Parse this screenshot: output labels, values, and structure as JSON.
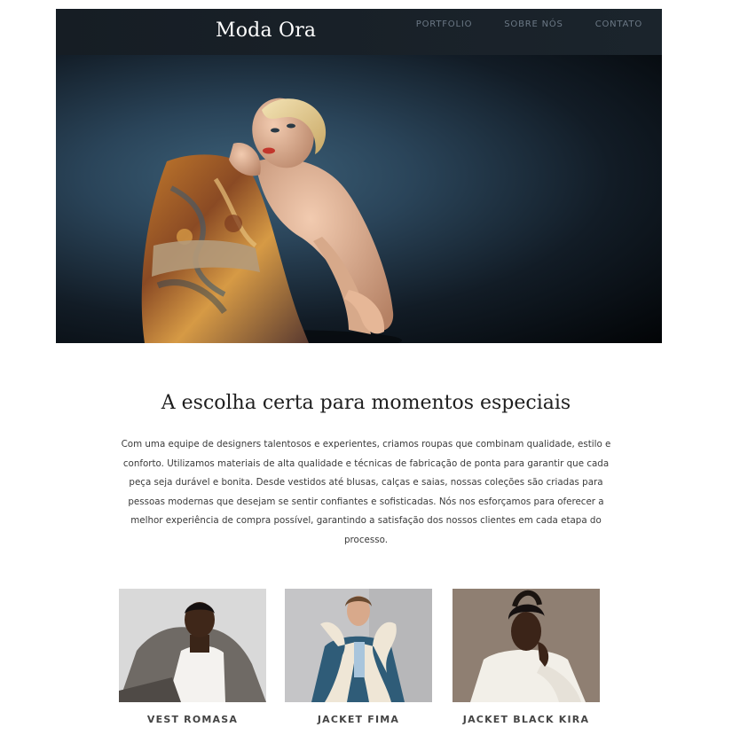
{
  "header": {
    "brand": "Moda Ora",
    "nav": [
      "PORTFOLIO",
      "SOBRE NÓS",
      "CONTATO"
    ]
  },
  "intro": {
    "title": "A escolha certa para momentos especiais",
    "text": "Com uma equipe de designers talentosos e experientes, criamos roupas que combinam qualidade, estilo e conforto. Utilizamos materiais de alta qualidade e técnicas de fabricação de ponta para garantir que cada peça seja durável e bonita. Desde vestidos até blusas, calças e saias, nossas coleções são criadas para pessoas modernas que desejam se sentir confiantes e sofisticadas. Nós nos esforçamos para oferecer a melhor experiência de compra possível, garantindo a satisfação dos nossos clientes em cada etapa do processo."
  },
  "products": [
    {
      "name": "VEST ROMASA"
    },
    {
      "name": "JACKET FIMA"
    },
    {
      "name": "JACKET BLACK KIRA"
    }
  ],
  "colors": {
    "header_bg": "#1b242c",
    "nav_text": "#6b7885",
    "brand_text": "#ffffff"
  }
}
